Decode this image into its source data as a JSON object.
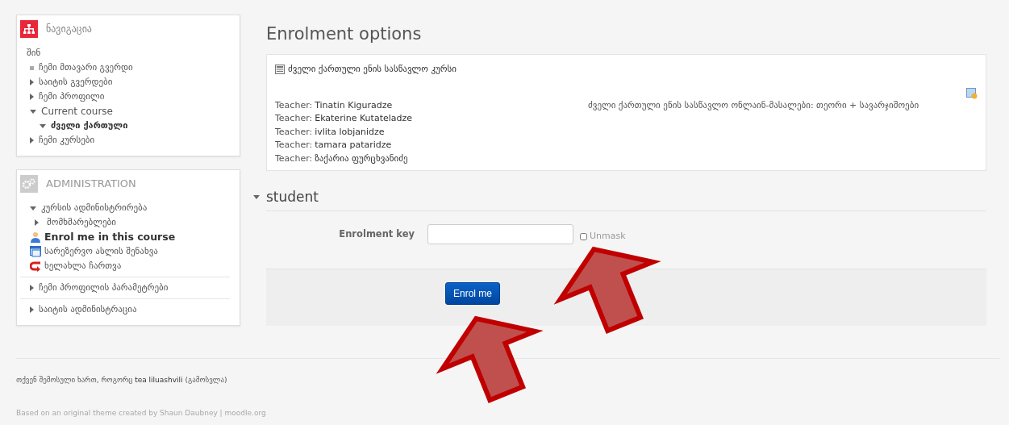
{
  "navigation": {
    "title": "ნავიგაცია",
    "items": [
      {
        "kind": "root",
        "label": "შინ"
      },
      {
        "kind": "leaf",
        "label": "ჩემი მთავარი გვერდი"
      },
      {
        "kind": "branch",
        "label": "საიტის გვერდები",
        "expanded": false
      },
      {
        "kind": "branch",
        "label": "ჩემი პროფილი",
        "expanded": false
      },
      {
        "kind": "branch",
        "label": "Current course",
        "expanded": true,
        "children": [
          {
            "kind": "branch",
            "label": "ძველი ქართული",
            "expanded": true,
            "selected": true
          }
        ]
      },
      {
        "kind": "branch",
        "label": "ჩემი კურსები",
        "expanded": false
      }
    ]
  },
  "administration": {
    "title": "ADMINISTRATION",
    "sections": [
      {
        "label": "კურსის ადმინისტრირება",
        "expanded": true,
        "children": [
          {
            "kind": "branch",
            "label": "მომხმარებლები",
            "expanded": false
          },
          {
            "kind": "enrol",
            "label": "Enrol me in this course"
          },
          {
            "kind": "backup",
            "label": "სარეზერვო ასლის შენახვა"
          },
          {
            "kind": "restore",
            "label": "ხელახლა ჩართვა"
          }
        ]
      },
      {
        "label": "ჩემი პროფილის პარამეტრები",
        "expanded": false
      },
      {
        "label": "საიტის ადმინისტრაცია",
        "expanded": false
      }
    ]
  },
  "main": {
    "heading": "Enrolment options",
    "course": {
      "name": "ძველი ქართული ენის სასწავლო კურსი",
      "summary": "ძველი ქართული ენის სასწავლო ონლაინ-მასალები: თეორი + სავარჯიშოები",
      "teachers": [
        {
          "role": "Teacher:",
          "name": "Tinatin Kiguradze"
        },
        {
          "role": "Teacher:",
          "name": "Ekaterine Kutateladze"
        },
        {
          "role": "Teacher:",
          "name": "ivlita lobjanidze"
        },
        {
          "role": "Teacher:",
          "name": "tamara pataridze"
        },
        {
          "role": "Teacher:",
          "name": "ზაქარია ფურცხვანიძე"
        }
      ]
    },
    "section": {
      "title": "student",
      "expanded": true
    },
    "key_label": "Enrolment key",
    "unmask": {
      "label": "Unmask",
      "checked": false
    },
    "submit": "Enrol me"
  },
  "footer": {
    "login_prefix": "თქვენ შემოსული ხართ, როგორც",
    "user": "tea liluashvili",
    "logout": "(გამოსვლა)",
    "credits": "Based on an original theme created by Shaun Daubney | moodle.org"
  }
}
